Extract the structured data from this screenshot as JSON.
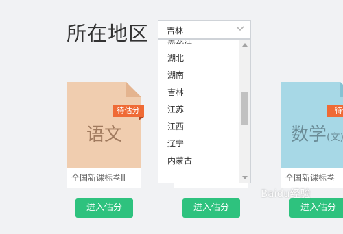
{
  "region": {
    "label": "所在地区",
    "selected": "吉林",
    "options": [
      "黑龙江",
      "湖北",
      "湖南",
      "吉林",
      "江苏",
      "江西",
      "辽宁",
      "内蒙古"
    ]
  },
  "cards": [
    {
      "subject": "语文",
      "subject_suffix": "",
      "tag": "待估分",
      "caption": "全国新课标卷II",
      "button": "进入估分"
    },
    {
      "button": "进入估分"
    },
    {
      "subject": "数学",
      "subject_suffix": "(文)",
      "tag": "待估",
      "caption": "全国新课标卷",
      "button": "进入估分"
    }
  ],
  "watermark": "Baidu经验",
  "colors": {
    "chinese_card": "#f0cdaf",
    "math_card": "#a7d8e6",
    "tag": "#ef6a35",
    "button": "#2ec27e"
  }
}
